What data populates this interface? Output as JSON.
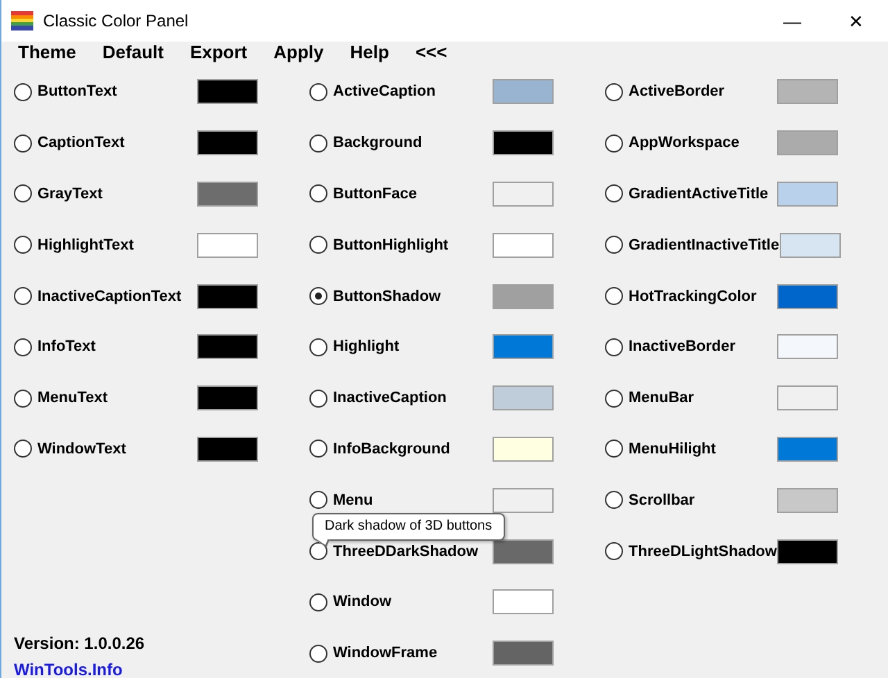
{
  "window": {
    "title": "Classic Color Panel",
    "minimize": "—",
    "close": "✕"
  },
  "menu": [
    "Theme",
    "Default",
    "Export",
    "Apply",
    "Help",
    "<<<"
  ],
  "columns": [
    {
      "items": [
        {
          "label": "ButtonText",
          "color": "#000000",
          "selected": false
        },
        {
          "label": "CaptionText",
          "color": "#000000",
          "selected": false
        },
        {
          "label": "GrayText",
          "color": "#6d6d6d",
          "selected": false
        },
        {
          "label": "HighlightText",
          "color": "#ffffff",
          "selected": false
        },
        {
          "label": "InactiveCaptionText",
          "color": "#000000",
          "selected": false
        },
        {
          "label": "InfoText",
          "color": "#000000",
          "selected": false
        },
        {
          "label": "MenuText",
          "color": "#000000",
          "selected": false
        },
        {
          "label": "WindowText",
          "color": "#000000",
          "selected": false
        }
      ]
    },
    {
      "items": [
        {
          "label": "ActiveCaption",
          "color": "#99b4d1",
          "selected": false
        },
        {
          "label": "Background",
          "color": "#000000",
          "selected": false
        },
        {
          "label": "ButtonFace",
          "color": "#f0f0f0",
          "selected": false
        },
        {
          "label": "ButtonHighlight",
          "color": "#ffffff",
          "selected": false
        },
        {
          "label": "ButtonShadow",
          "color": "#a0a0a0",
          "selected": true
        },
        {
          "label": "Highlight",
          "color": "#0078d7",
          "selected": false
        },
        {
          "label": "InactiveCaption",
          "color": "#bfcddb",
          "selected": false
        },
        {
          "label": "InfoBackground",
          "color": "#ffffe1",
          "selected": false
        },
        {
          "label": "Menu",
          "color": "#f0f0f0",
          "selected": false
        },
        {
          "label": "ThreeDDarkShadow",
          "color": "#696969",
          "selected": false,
          "tooltip": "Dark shadow of 3D buttons"
        },
        {
          "label": "Window",
          "color": "#ffffff",
          "selected": false
        },
        {
          "label": "WindowFrame",
          "color": "#646464",
          "selected": false
        }
      ]
    },
    {
      "items": [
        {
          "label": "ActiveBorder",
          "color": "#b4b4b4",
          "selected": false
        },
        {
          "label": "AppWorkspace",
          "color": "#ababab",
          "selected": false
        },
        {
          "label": "GradientActiveTitle",
          "color": "#b9d1ea",
          "selected": false
        },
        {
          "label": "GradientInactiveTitle",
          "color": "#d7e4f2",
          "selected": false
        },
        {
          "label": "HotTrackingColor",
          "color": "#0066cc",
          "selected": false
        },
        {
          "label": "InactiveBorder",
          "color": "#f4f7fc",
          "selected": false
        },
        {
          "label": "MenuBar",
          "color": "#f0f0f0",
          "selected": false
        },
        {
          "label": "MenuHilight",
          "color": "#0078d7",
          "selected": false
        },
        {
          "label": "Scrollbar",
          "color": "#c8c8c8",
          "selected": false
        },
        {
          "label": "ThreeDLightShadow",
          "color": "#000000",
          "selected": false
        }
      ]
    }
  ],
  "footer": {
    "version": "Version: 1.0.0.26",
    "link": "WinTools.Info"
  }
}
